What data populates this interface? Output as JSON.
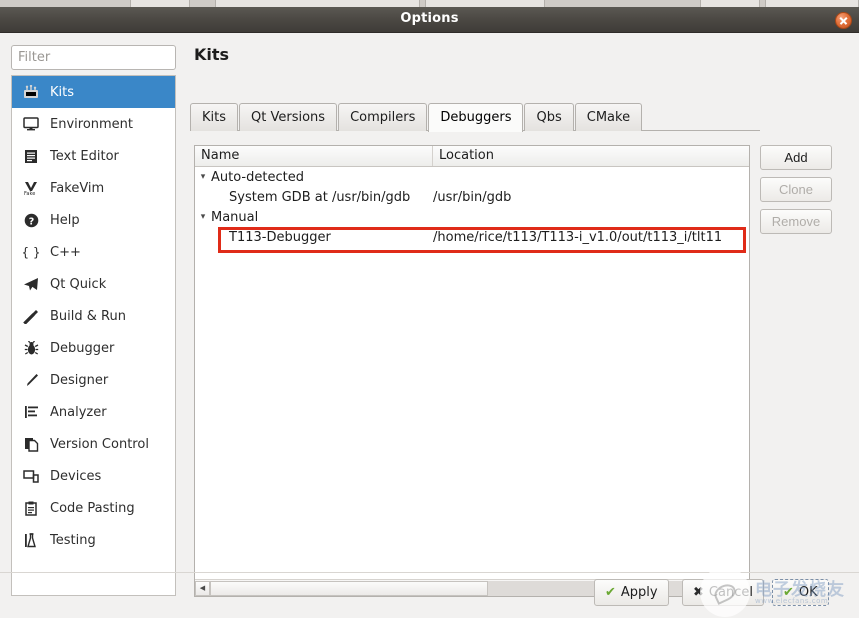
{
  "window": {
    "title": "Options",
    "close_label": "×"
  },
  "sidebar": {
    "filter_placeholder": "Filter",
    "filter_value": "",
    "items": [
      {
        "label": "Kits",
        "icon": "kits-icon",
        "active": true
      },
      {
        "label": "Environment",
        "icon": "monitor-icon",
        "active": false
      },
      {
        "label": "Text Editor",
        "icon": "document-lines-icon",
        "active": false
      },
      {
        "label": "FakeVim",
        "icon": "fakevim-icon",
        "active": false
      },
      {
        "label": "Help",
        "icon": "question-mark-icon",
        "active": false
      },
      {
        "label": "C++",
        "icon": "braces-icon",
        "active": false
      },
      {
        "label": "Qt Quick",
        "icon": "paper-plane-icon",
        "active": false
      },
      {
        "label": "Build & Run",
        "icon": "hammer-icon",
        "active": false
      },
      {
        "label": "Debugger",
        "icon": "bug-icon",
        "active": false
      },
      {
        "label": "Designer",
        "icon": "pencil-icon",
        "active": false
      },
      {
        "label": "Analyzer",
        "icon": "bar-list-icon",
        "active": false
      },
      {
        "label": "Version Control",
        "icon": "copy-pages-icon",
        "active": false
      },
      {
        "label": "Devices",
        "icon": "device-screen-icon",
        "active": false
      },
      {
        "label": "Code Pasting",
        "icon": "clipboard-icon",
        "active": false
      },
      {
        "label": "Testing",
        "icon": "flask-icon",
        "active": false
      }
    ]
  },
  "main": {
    "page_title": "Kits",
    "tabs": [
      {
        "label": "Kits",
        "active": false
      },
      {
        "label": "Qt Versions",
        "active": false
      },
      {
        "label": "Compilers",
        "active": false
      },
      {
        "label": "Debuggers",
        "active": true
      },
      {
        "label": "Qbs",
        "active": false
      },
      {
        "label": "CMake",
        "active": false
      }
    ],
    "table": {
      "columns": [
        "Name",
        "Location"
      ],
      "rows": [
        {
          "kind": "group",
          "twisty": "▾",
          "name": "Auto-detected",
          "location": "",
          "highlighted": false
        },
        {
          "kind": "child",
          "twisty": "",
          "name": "System GDB at /usr/bin/gdb",
          "location": "/usr/bin/gdb",
          "highlighted": false
        },
        {
          "kind": "group",
          "twisty": "▾",
          "name": "Manual",
          "location": "",
          "highlighted": false
        },
        {
          "kind": "child",
          "twisty": "",
          "name": "T113-Debugger",
          "location": "/home/rice/t113/T113-i_v1.0/out/t113_i/tlt11",
          "highlighted": true
        }
      ]
    },
    "side_buttons": [
      {
        "label": "Add",
        "enabled": true
      },
      {
        "label": "Clone",
        "enabled": false
      },
      {
        "label": "Remove",
        "enabled": false
      }
    ],
    "scrollbar": {
      "left_arrow": "◀",
      "right_arrow": "▶"
    }
  },
  "footer": {
    "apply": {
      "label": "Apply",
      "glyph": "✔"
    },
    "cancel": {
      "label": "Cancel",
      "glyph": "✖"
    },
    "ok": {
      "label": "OK",
      "glyph": "✔"
    }
  },
  "watermark": {
    "text": "电子发烧友",
    "subtext": "www.elecfans.com"
  },
  "colors": {
    "accent": "#3a87c8",
    "annotation": "#e02b18",
    "titlebar": "#4b4843",
    "close": "#e2703a",
    "check": "#6aa832"
  }
}
